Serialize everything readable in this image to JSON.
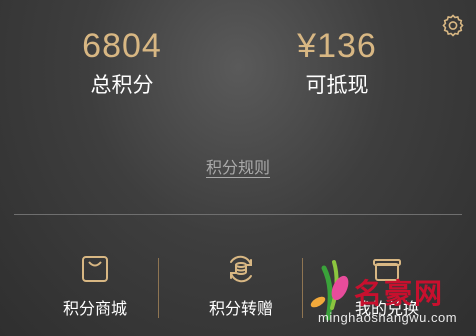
{
  "header": {
    "settings_icon": "gear-icon"
  },
  "stats": {
    "total_points": {
      "value": "6804",
      "label": "总积分"
    },
    "cashable": {
      "value": "¥136",
      "label": "可抵现"
    }
  },
  "rules_link": "积分规则",
  "menu": {
    "items": [
      {
        "label": "积分商城",
        "icon": "shopping-bag-icon"
      },
      {
        "label": "积分转赠",
        "icon": "coins-transfer-icon"
      },
      {
        "label": "我的兑换",
        "icon": "gift-box-icon"
      }
    ]
  },
  "watermark": {
    "title": "名豪网",
    "url": "minghaoshangwu.com"
  },
  "colors": {
    "accent_gold": "#d8b783",
    "background": "#3e3e3e",
    "watermark_red": "#c8102e"
  }
}
